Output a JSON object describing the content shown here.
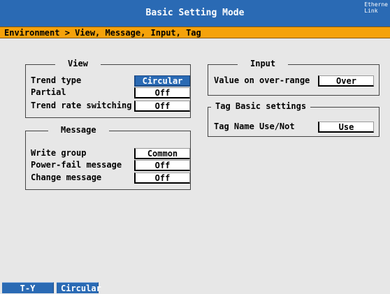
{
  "header": {
    "title": "Basic Setting Mode",
    "ethernet_line1": "Etherne",
    "ethernet_line2": "Link"
  },
  "breadcrumb": "Environment > View, Message, Input, Tag",
  "view": {
    "legend": "View",
    "rows": [
      {
        "label": "Trend type",
        "value": "Circular"
      },
      {
        "label": "Partial",
        "value": "Off"
      },
      {
        "label": "Trend rate switching",
        "value": "Off"
      }
    ]
  },
  "message": {
    "legend": "Message",
    "rows": [
      {
        "label": "Write group",
        "value": "Common"
      },
      {
        "label": "Power-fail message",
        "value": "Off"
      },
      {
        "label": "Change message",
        "value": "Off"
      }
    ]
  },
  "input": {
    "legend": "Input",
    "label": "Value on over-range",
    "value": "Over"
  },
  "tag": {
    "legend": "Tag Basic settings",
    "label": "Tag Name Use/Not",
    "value": "Use"
  },
  "softkeys": [
    "T-Y",
    "Circular"
  ],
  "colors": {
    "title_bar": "#2a6ab4",
    "breadcrumb_bar": "#f5a20a",
    "background": "#e7e7e7",
    "selected": "#2a6ab4"
  }
}
